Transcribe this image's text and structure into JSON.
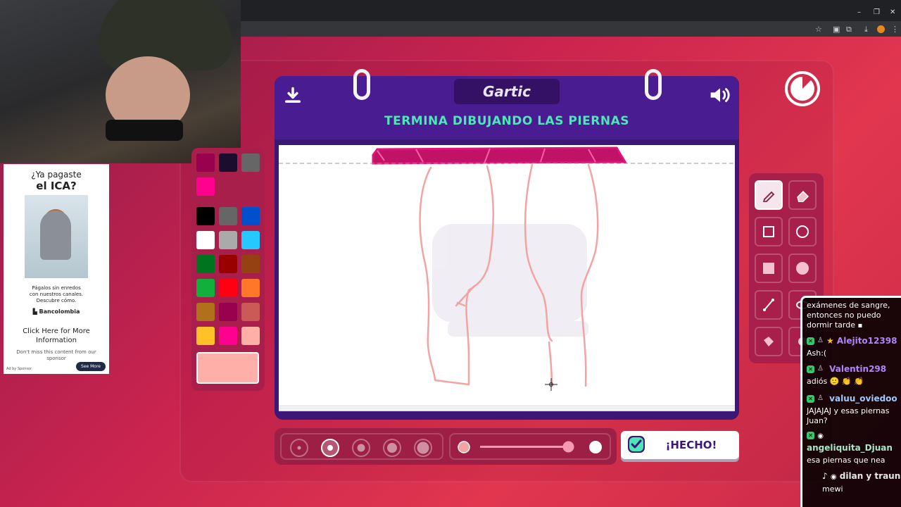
{
  "window": {
    "minimize": "–",
    "maximize": "❐",
    "close": "✕"
  },
  "game": {
    "logo": "Gartic",
    "title": "TERMINA DIBUJANDO LAS PIERNAS",
    "done_label": "¡HECHO!",
    "icons": {
      "download": "download-icon",
      "volume": "volume-icon",
      "timer": "timer-icon"
    },
    "brush_sizes": [
      1,
      2,
      3,
      4,
      5
    ],
    "selected_brush_size": 2,
    "opacity_fraction": 0.96,
    "palette": {
      "colors": [
        "#000000",
        "#666666",
        "#0050cd",
        "#ffffff",
        "#aaaaaa",
        "#26c9ff",
        "#017420",
        "#990000",
        "#964112",
        "#11b03c",
        "#ff0013",
        "#ff7829",
        "#b0701c",
        "#99004e",
        "#cb5a57",
        "#ffc126",
        "#ff008f",
        "#feafa8"
      ],
      "top_partial": [
        "#99004e",
        "#1a0d2e",
        "#666666"
      ],
      "recent": "#ff008f",
      "selected": "#feafa8"
    },
    "tools": [
      {
        "name": "pencil",
        "active": true
      },
      {
        "name": "eraser",
        "active": false
      },
      {
        "name": "rectangle-outline",
        "active": false
      },
      {
        "name": "circle-outline",
        "active": false
      },
      {
        "name": "rectangle-fill",
        "active": false
      },
      {
        "name": "circle-fill",
        "active": false
      },
      {
        "name": "line",
        "active": false
      },
      {
        "name": "ellipse",
        "active": false
      },
      {
        "name": "fill-bucket",
        "active": false
      },
      {
        "name": "other",
        "active": false
      }
    ],
    "colors": {
      "board": "#3b1776",
      "title": "#4ee6b8",
      "stroke": "#f4a3a3",
      "skirt": "#e0137a"
    }
  },
  "ad": {
    "question": "¿Ya pagaste",
    "headline": "el ICA?",
    "body_line1": "Págalos sin enredos",
    "body_line2": "con nuestros canales.",
    "body_line3": "Descubre cómo.",
    "brand": "Bancolombia",
    "cta_line1": "Click Here for More",
    "cta_line2": "Information",
    "sub_line1": "Don't miss this content from our",
    "sub_line2": "sponsor",
    "footer": "Ad by Sponsor",
    "button": "See More"
  },
  "chat": {
    "messages": [
      {
        "user": "",
        "text1": "exámenes de sangre,",
        "text2": "entonces no puedo",
        "text3": "dormir tarde"
      },
      {
        "user": "Alejito12398",
        "color": "#b184ff",
        "text": "Ash:("
      },
      {
        "user": "Valentin298",
        "color": "#b184ff",
        "text": "adiós 🙂 👏 👏"
      },
      {
        "user": "valuu_oviedoo",
        "color": "#9ec9ff",
        "text1": "JAJAJAJ y esas piernas",
        "text2": "Juan?"
      },
      {
        "user": "angeliquita_Djuan",
        "color": "#a8e6c8",
        "text": "esa piernas que nea"
      },
      {
        "user": "dilan y traun",
        "color": "#e8e8e8",
        "text": "mewi"
      }
    ]
  }
}
